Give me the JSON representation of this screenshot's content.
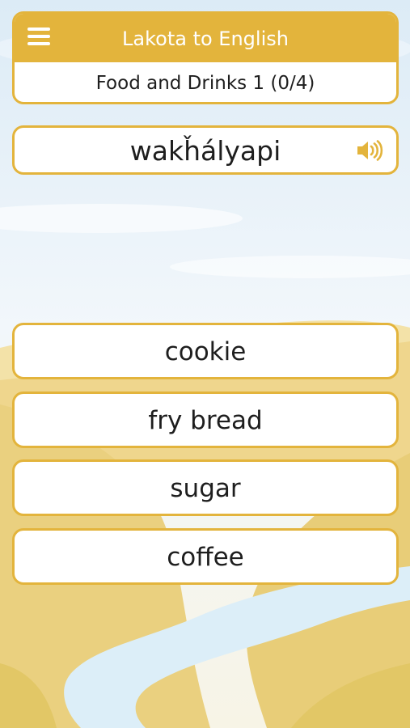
{
  "header": {
    "title": "Lakota to English",
    "lesson_progress": "Food and Drinks 1 (0/4)"
  },
  "prompt": {
    "word": "wakȟályapi"
  },
  "answers": [
    {
      "label": "cookie"
    },
    {
      "label": "fry bread"
    },
    {
      "label": "sugar"
    },
    {
      "label": "coffee"
    }
  ],
  "colors": {
    "accent": "#e3b43c",
    "card": "#ffffff",
    "text": "#1e1e1e"
  },
  "icons": {
    "menu": "hamburger-menu-icon",
    "audio": "speaker-icon"
  }
}
